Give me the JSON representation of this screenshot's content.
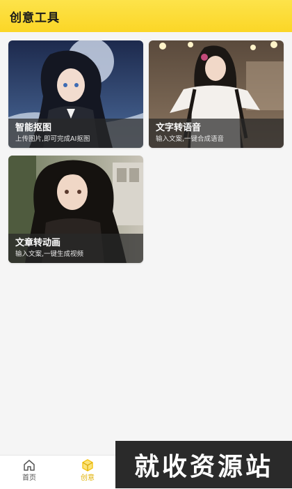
{
  "header": {
    "title": "创意工具"
  },
  "cards": [
    {
      "title": "智能抠图",
      "subtitle": "上传图片,即可完成AI抠图"
    },
    {
      "title": "文字转语音",
      "subtitle": "输入文案,一键合成语音"
    },
    {
      "title": "文章转动画",
      "subtitle": "输入文案,一键生成视频"
    }
  ],
  "nav": {
    "items": [
      {
        "label": "首页",
        "icon": "home-icon"
      },
      {
        "label": "创意",
        "icon": "creative-icon"
      }
    ],
    "active_color": "#f5c518"
  },
  "watermark": {
    "text": "就收资源站"
  }
}
